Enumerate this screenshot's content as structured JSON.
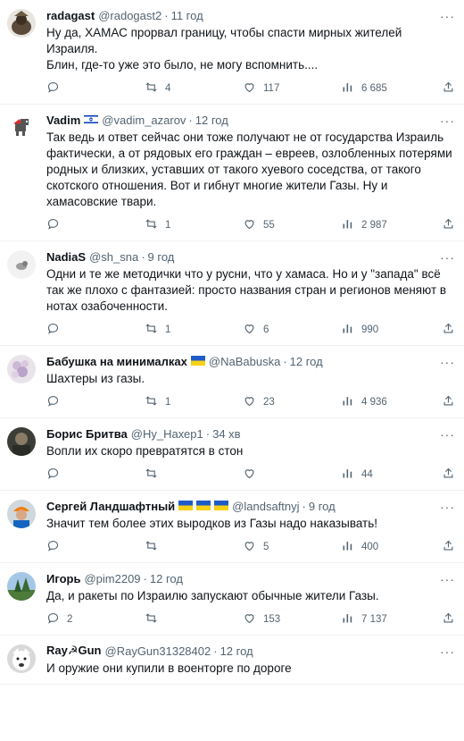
{
  "tweets": [
    {
      "name": "radagast",
      "handle": "@radogast2",
      "time": "11 год",
      "flags": "",
      "text": "Ну да, ХАМАС прорвал границу, чтобы спасти мирных жителей Израиля.\nБлин, где-то уже это было, не могу вспомнить....",
      "reply": "",
      "retweet": "4",
      "like": "117",
      "views": "6 685",
      "avatar": "radagast-avatar"
    },
    {
      "name": "Vadim",
      "handle": "@vadim_azarov",
      "time": "12 год",
      "flags": "israel-flag",
      "text": "Так ведь и ответ сейчас они тоже получают не от государства Израиль фактически, а от рядовых его граждан – евреев, озлобленных потерями родных и близких, уставших от такого хуевого соседства, от такого скотского отношения. Вот и гибнут многие жители Газы. Ну и хамасовские твари.",
      "reply": "",
      "retweet": "1",
      "like": "55",
      "views": "2 987",
      "avatar": "vadim-avatar"
    },
    {
      "name": "NadiaS",
      "handle": "@sh_sna",
      "time": "9 год",
      "flags": "",
      "text": "Одни и те же методички что у русни, что у хамаса. Но и у \"запада\" всё так же плохо с фантазией: просто названия стран и регионов меняют в нотах озабоченности.",
      "reply": "",
      "retweet": "1",
      "like": "6",
      "views": "990",
      "avatar": "nadias-avatar"
    },
    {
      "name": "Бабушка на минималках",
      "handle": "@NaBabuska",
      "time": "12 год",
      "flags": "ukraine-flag",
      "text": "Шахтеры из газы.",
      "reply": "",
      "retweet": "1",
      "like": "23",
      "views": "4 936",
      "avatar": "babushka-avatar"
    },
    {
      "name": "Борис Бритва",
      "handle": "@Ну_Нахер1",
      "time": "34 хв",
      "flags": "",
      "text": "Вопли их скоро превратятся в стон",
      "reply": "",
      "retweet": "",
      "like": "",
      "views": "44",
      "avatar": "boris-avatar"
    },
    {
      "name": "Сергей Ландшафтный",
      "handle": "@landsaftnyj",
      "time": "9 год",
      "flags": "ukraine-flag-x3",
      "text": "Значит тем более этих выродков из Газы надо наказывать!",
      "reply": "",
      "retweet": "",
      "like": "5",
      "views": "400",
      "avatar": "sergey-avatar"
    },
    {
      "name": "Игорь",
      "handle": "@pim2209",
      "time": "12 год",
      "flags": "",
      "text": "Да, и ракеты по Израилю запускают обычные жители Газы.",
      "reply": "2",
      "retweet": "",
      "like": "153",
      "views": "7 137",
      "avatar": "igor-avatar"
    },
    {
      "name": "Ray☭Gun",
      "handle": "@RayGun31328402",
      "time": "12 год",
      "flags": "",
      "text": "И оружие они купили в военторге по дороге",
      "reply": "",
      "retweet": "",
      "like": "",
      "views": "",
      "avatar": "raygun-avatar"
    }
  ],
  "sep": "·",
  "colors": {
    "text": "#0f1419",
    "secondary": "#536471",
    "border": "#eff3f4",
    "ukraine_blue": "#1e5bc6",
    "ukraine_yellow": "#f7d117",
    "israel_blue": "#0038b8"
  }
}
